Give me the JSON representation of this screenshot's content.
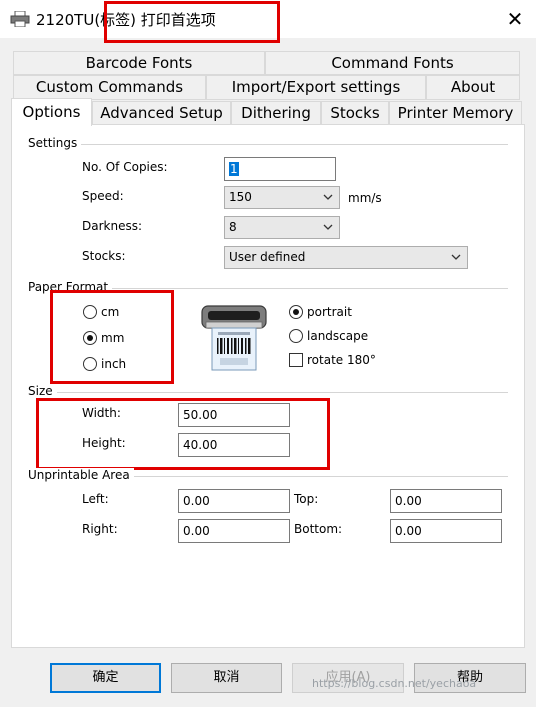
{
  "window": {
    "title": "2120TU(标签) 打印首选项"
  },
  "tabs": {
    "row1": [
      "Barcode Fonts",
      "Command Fonts"
    ],
    "row2": [
      "Custom Commands",
      "Import/Export settings",
      "About"
    ],
    "row3": [
      "Options",
      "Advanced Setup",
      "Dithering",
      "Stocks",
      "Printer Memory"
    ],
    "active": "Options"
  },
  "settings": {
    "group_label": "Settings",
    "copies_label": "No. Of Copies:",
    "copies_value": "1",
    "speed_label": "Speed:",
    "speed_value": "150",
    "speed_unit": "mm/s",
    "darkness_label": "Darkness:",
    "darkness_value": "8",
    "stocks_label": "Stocks:",
    "stocks_value": "User defined"
  },
  "paper_format": {
    "group_label": "Paper Format",
    "units": [
      "cm",
      "mm",
      "inch"
    ],
    "selected_unit": "mm",
    "orientation": [
      "portrait",
      "landscape"
    ],
    "selected_orientation": "portrait",
    "rotate_label": "rotate 180°",
    "rotate_checked": false
  },
  "size": {
    "group_label": "Size",
    "width_label": "Width:",
    "width_value": "50.00",
    "height_label": "Height:",
    "height_value": "40.00"
  },
  "unprintable": {
    "group_label": "Unprintable Area",
    "left_label": "Left:",
    "left_value": "0.00",
    "top_label": "Top:",
    "top_value": "0.00",
    "right_label": "Right:",
    "right_value": "0.00",
    "bottom_label": "Bottom:",
    "bottom_value": "0.00"
  },
  "buttons": {
    "ok": "确定",
    "cancel": "取消",
    "apply": "应用(A)",
    "help": "帮助"
  },
  "watermark": "https://blog.csdn.net/yechaoa",
  "colors": {
    "annotation_red": "#e00000",
    "focus_blue": "#0078d7"
  }
}
